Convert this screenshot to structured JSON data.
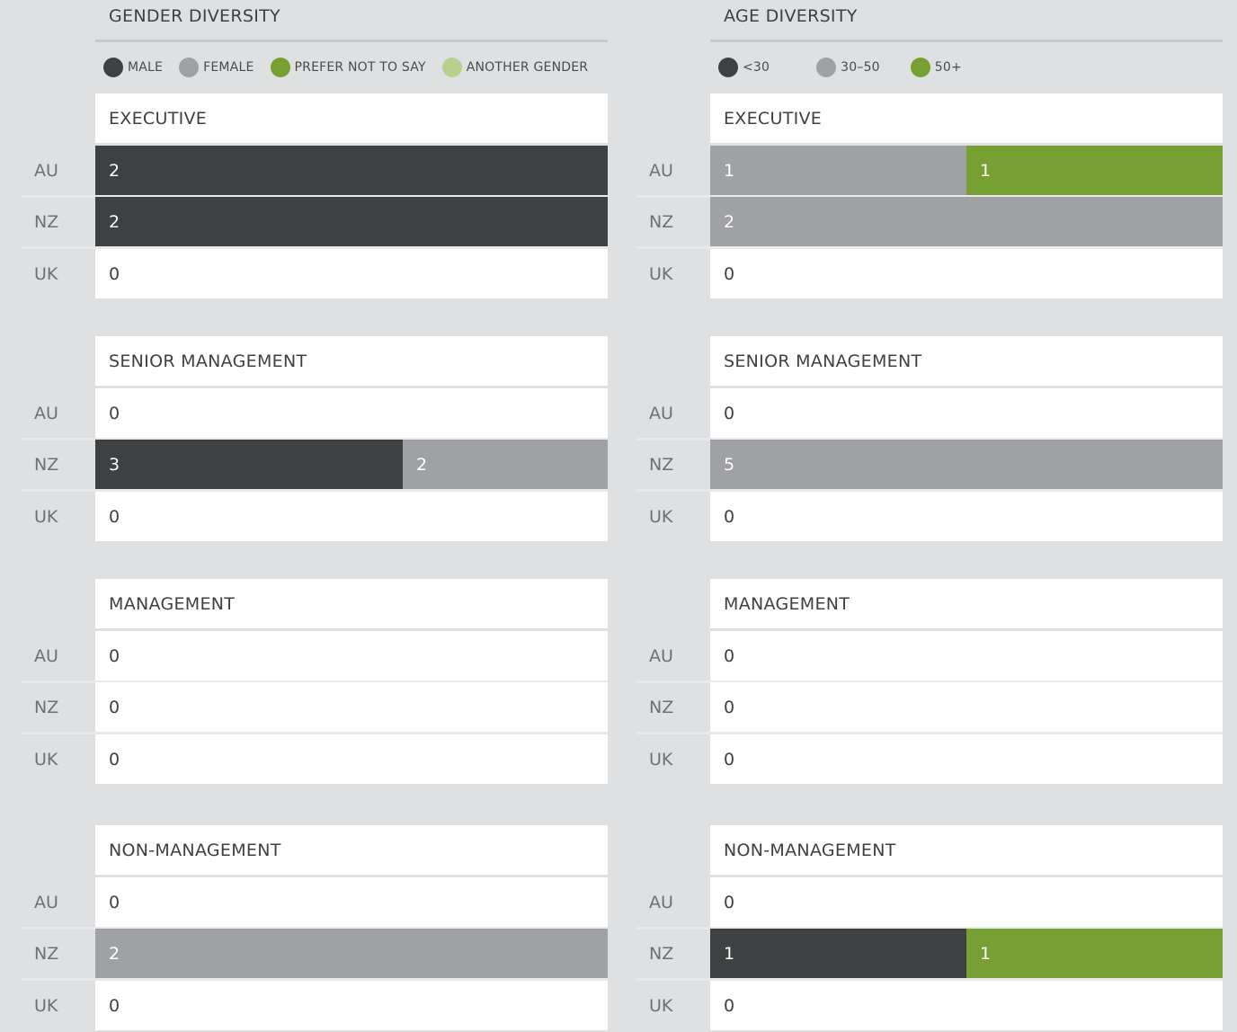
{
  "colors": {
    "male": "#3f4042",
    "female": "#a0a1a4",
    "prefer_not_to_say": "#76a132",
    "another_gender": "#b6d08d",
    "age_lt30": "#3f4042",
    "age_30_50": "#a0a1a4",
    "age_50_plus": "#76a132"
  },
  "chart_data": [
    {
      "type": "bar",
      "stacked": true,
      "orientation": "horizontal",
      "title": "GENDER DIVERSITY",
      "legend": [
        {
          "key": "male",
          "label": "MALE",
          "color": "#3f4042"
        },
        {
          "key": "female",
          "label": "FEMALE",
          "color": "#a0a1a4"
        },
        {
          "key": "prefer_not_to_say",
          "label": "PREFER NOT TO SAY",
          "color": "#76a132"
        },
        {
          "key": "another_gender",
          "label": "ANOTHER GENDER",
          "color": "#b6d08d"
        }
      ],
      "groups": [
        {
          "title": "EXECUTIVE",
          "rows": [
            {
              "region": "AU",
              "values": {
                "male": 2,
                "female": 0,
                "prefer_not_to_say": 0,
                "another_gender": 0
              }
            },
            {
              "region": "NZ",
              "values": {
                "male": 2,
                "female": 0,
                "prefer_not_to_say": 0,
                "another_gender": 0
              }
            },
            {
              "region": "UK",
              "values": {
                "male": 0,
                "female": 0,
                "prefer_not_to_say": 0,
                "another_gender": 0
              }
            }
          ]
        },
        {
          "title": "SENIOR MANAGEMENT",
          "rows": [
            {
              "region": "AU",
              "values": {
                "male": 0,
                "female": 0,
                "prefer_not_to_say": 0,
                "another_gender": 0
              }
            },
            {
              "region": "NZ",
              "values": {
                "male": 3,
                "female": 2,
                "prefer_not_to_say": 0,
                "another_gender": 0
              }
            },
            {
              "region": "UK",
              "values": {
                "male": 0,
                "female": 0,
                "prefer_not_to_say": 0,
                "another_gender": 0
              }
            }
          ]
        },
        {
          "title": "MANAGEMENT",
          "rows": [
            {
              "region": "AU",
              "values": {
                "male": 0,
                "female": 0,
                "prefer_not_to_say": 0,
                "another_gender": 0
              }
            },
            {
              "region": "NZ",
              "values": {
                "male": 0,
                "female": 0,
                "prefer_not_to_say": 0,
                "another_gender": 0
              }
            },
            {
              "region": "UK",
              "values": {
                "male": 0,
                "female": 0,
                "prefer_not_to_say": 0,
                "another_gender": 0
              }
            }
          ]
        },
        {
          "title": "NON-MANAGEMENT",
          "rows": [
            {
              "region": "AU",
              "values": {
                "male": 0,
                "female": 0,
                "prefer_not_to_say": 0,
                "another_gender": 0
              }
            },
            {
              "region": "NZ",
              "values": {
                "male": 0,
                "female": 2,
                "prefer_not_to_say": 0,
                "another_gender": 0
              }
            },
            {
              "region": "UK",
              "values": {
                "male": 0,
                "female": 0,
                "prefer_not_to_say": 0,
                "another_gender": 0
              }
            }
          ]
        }
      ]
    },
    {
      "type": "bar",
      "stacked": true,
      "orientation": "horizontal",
      "title": "AGE DIVERSITY",
      "legend": [
        {
          "key": "lt30",
          "label": "<30",
          "color": "#3f4042"
        },
        {
          "key": "30_50",
          "label": "30–50",
          "color": "#a0a1a4"
        },
        {
          "key": "50_plus",
          "label": "50+",
          "color": "#76a132"
        }
      ],
      "groups": [
        {
          "title": "EXECUTIVE",
          "rows": [
            {
              "region": "AU",
              "values": {
                "lt30": 0,
                "30_50": 1,
                "50_plus": 1
              }
            },
            {
              "region": "NZ",
              "values": {
                "lt30": 0,
                "30_50": 2,
                "50_plus": 0
              }
            },
            {
              "region": "UK",
              "values": {
                "lt30": 0,
                "30_50": 0,
                "50_plus": 0
              }
            }
          ]
        },
        {
          "title": "SENIOR MANAGEMENT",
          "rows": [
            {
              "region": "AU",
              "values": {
                "lt30": 0,
                "30_50": 0,
                "50_plus": 0
              }
            },
            {
              "region": "NZ",
              "values": {
                "lt30": 0,
                "30_50": 5,
                "50_plus": 0
              }
            },
            {
              "region": "UK",
              "values": {
                "lt30": 0,
                "30_50": 0,
                "50_plus": 0
              }
            }
          ]
        },
        {
          "title": "MANAGEMENT",
          "rows": [
            {
              "region": "AU",
              "values": {
                "lt30": 0,
                "30_50": 0,
                "50_plus": 0
              }
            },
            {
              "region": "NZ",
              "values": {
                "lt30": 0,
                "30_50": 0,
                "50_plus": 0
              }
            },
            {
              "region": "UK",
              "values": {
                "lt30": 0,
                "30_50": 0,
                "50_plus": 0
              }
            }
          ]
        },
        {
          "title": "NON-MANAGEMENT",
          "rows": [
            {
              "region": "AU",
              "values": {
                "lt30": 0,
                "30_50": 0,
                "50_plus": 0
              }
            },
            {
              "region": "NZ",
              "values": {
                "lt30": 1,
                "30_50": 0,
                "50_plus": 1
              }
            },
            {
              "region": "UK",
              "values": {
                "lt30": 0,
                "30_50": 0,
                "50_plus": 0
              }
            }
          ]
        }
      ]
    }
  ]
}
